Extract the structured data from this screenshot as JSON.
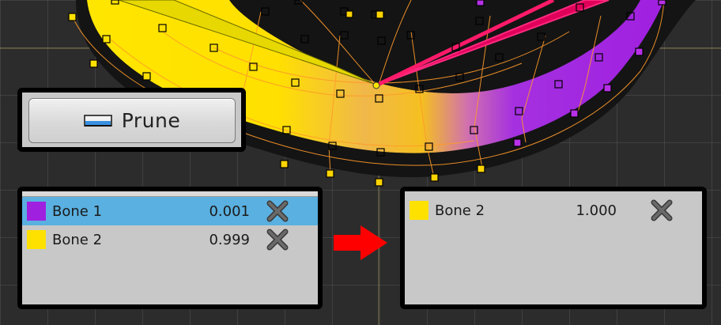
{
  "toolbar": {
    "prune_label": "Prune",
    "prune_icon": "prune-eraser-icon"
  },
  "before_panel": {
    "rows": [
      {
        "bone": "Bone 1",
        "weight": "0.001",
        "color": "#a020e0",
        "selected": true,
        "remove_icon": "close-x-icon"
      },
      {
        "bone": "Bone 2",
        "weight": "0.999",
        "color": "#ffe100",
        "selected": false,
        "remove_icon": "close-x-icon"
      }
    ]
  },
  "after_panel": {
    "rows": [
      {
        "bone": "Bone 2",
        "weight": "1.000",
        "color": "#ffe100",
        "selected": false,
        "remove_icon": "close-x-icon"
      }
    ]
  },
  "transition_icon": "right-arrow-icon",
  "colors": {
    "accent_selected": "#5ab0e0",
    "arrow": "#ff0000",
    "mesh_yellow": "#ffe100",
    "mesh_purple": "#a020e0",
    "mesh_orange": "#ff8c1a"
  }
}
